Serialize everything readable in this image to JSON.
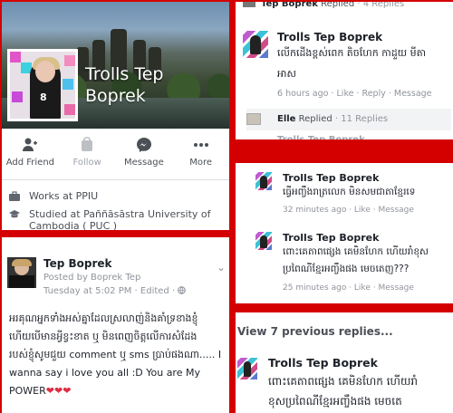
{
  "profile": {
    "name_line1": "Trolls Tep",
    "name_line2": "Boprek",
    "avatar_number": "8",
    "actions": [
      {
        "label": "Add Friend",
        "icon": "add-friend-icon"
      },
      {
        "label": "Follow",
        "icon": "follow-icon"
      },
      {
        "label": "Message",
        "icon": "messenger-icon"
      },
      {
        "label": "More",
        "icon": "more-icon"
      }
    ],
    "works_at": "Works at PPIU",
    "studied_line1": "Studied at Paññāsāstra University of",
    "studied_line2": "Cambodia ( PUC )"
  },
  "post": {
    "author": "Tep Boprek",
    "posted_by": "Posted by Boprek Tep",
    "time": "Tuesday at 5:02 PM · Edited ·",
    "line1": "អរគុណអ្នកទាំងអស់គ្នាដែលស្រលាញ់និងគាំទ្រខាងខ្ញុំ",
    "line2": "ហើយបើមានអ្វីខ្វះខាត ឬ មិនពេញចិត្តលើការសំដែង",
    "line3": "របស់ខ្ញុំសូមជួយ comment ឬ sms ប្រាប់ផងណា..... I",
    "line4": "wanna say i love you all :D You are My",
    "line5": "POWER",
    "hearts": "❤❤❤"
  },
  "top_comments": {
    "partial_name": "Tep Boprek",
    "partial_replied": "Replied",
    "partial_count": "· 4 Replies",
    "comment": {
      "author": "Trolls Tep Boprek",
      "text1": "លើកដើងខ្ពស់ពេក តិចហែក កាដួយ មីតា",
      "text2": "អាស",
      "meta": "6 hours ago · Like · Reply · Message"
    },
    "reply_row": {
      "name": "Elle",
      "replied": "Replied",
      "count": "· 11 Replies"
    },
    "cut_off": "Trolls Tep Boprek"
  },
  "mid_comments": [
    {
      "author": "Trolls Tep Boprek",
      "text1": "ធ្វើអញ្ចឹងរាត្រលេក មិនសមជាតាខ្មែរទេ",
      "text2": "",
      "meta": "32 minutes ago · Like · Message"
    },
    {
      "author": "Trolls Tep Boprek",
      "text1": "ពោះគេតាពផ្សេង គេមិនហែក ហើយរាំខុស",
      "text2": "ប្រពៃណីខ្មែរអញ្ចឹងផង មេចតេញ???",
      "meta": "25 minutes ago · Like · Message"
    }
  ],
  "bottom_comments": {
    "view_previous": "View 7 previous replies...",
    "author": "Trolls Tep Boprek",
    "text1": "ពោះគេតាពផ្សេង គេមិនហែក ហើយរាំ",
    "text2": "ខុសប្រពៃណីខ្មែរអញ្ចឹងផង មេចតេ"
  },
  "colors": {
    "frame_red": "#d40000",
    "meta_gray": "#90949c",
    "text_dark": "#1d2129"
  }
}
